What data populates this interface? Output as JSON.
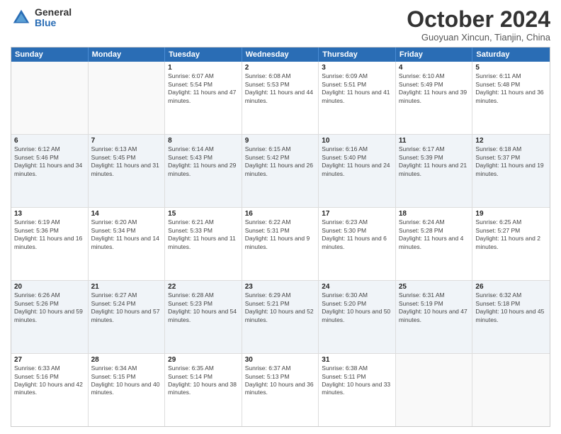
{
  "logo": {
    "general": "General",
    "blue": "Blue"
  },
  "title": "October 2024",
  "subtitle": "Guoyuan Xincun, Tianjin, China",
  "header_days": [
    "Sunday",
    "Monday",
    "Tuesday",
    "Wednesday",
    "Thursday",
    "Friday",
    "Saturday"
  ],
  "weeks": [
    [
      {
        "day": "",
        "sunrise": "",
        "sunset": "",
        "daylight": "",
        "empty": true
      },
      {
        "day": "",
        "sunrise": "",
        "sunset": "",
        "daylight": "",
        "empty": true
      },
      {
        "day": "1",
        "sunrise": "Sunrise: 6:07 AM",
        "sunset": "Sunset: 5:54 PM",
        "daylight": "Daylight: 11 hours and 47 minutes.",
        "empty": false
      },
      {
        "day": "2",
        "sunrise": "Sunrise: 6:08 AM",
        "sunset": "Sunset: 5:53 PM",
        "daylight": "Daylight: 11 hours and 44 minutes.",
        "empty": false
      },
      {
        "day": "3",
        "sunrise": "Sunrise: 6:09 AM",
        "sunset": "Sunset: 5:51 PM",
        "daylight": "Daylight: 11 hours and 41 minutes.",
        "empty": false
      },
      {
        "day": "4",
        "sunrise": "Sunrise: 6:10 AM",
        "sunset": "Sunset: 5:49 PM",
        "daylight": "Daylight: 11 hours and 39 minutes.",
        "empty": false
      },
      {
        "day": "5",
        "sunrise": "Sunrise: 6:11 AM",
        "sunset": "Sunset: 5:48 PM",
        "daylight": "Daylight: 11 hours and 36 minutes.",
        "empty": false
      }
    ],
    [
      {
        "day": "6",
        "sunrise": "Sunrise: 6:12 AM",
        "sunset": "Sunset: 5:46 PM",
        "daylight": "Daylight: 11 hours and 34 minutes.",
        "empty": false
      },
      {
        "day": "7",
        "sunrise": "Sunrise: 6:13 AM",
        "sunset": "Sunset: 5:45 PM",
        "daylight": "Daylight: 11 hours and 31 minutes.",
        "empty": false
      },
      {
        "day": "8",
        "sunrise": "Sunrise: 6:14 AM",
        "sunset": "Sunset: 5:43 PM",
        "daylight": "Daylight: 11 hours and 29 minutes.",
        "empty": false
      },
      {
        "day": "9",
        "sunrise": "Sunrise: 6:15 AM",
        "sunset": "Sunset: 5:42 PM",
        "daylight": "Daylight: 11 hours and 26 minutes.",
        "empty": false
      },
      {
        "day": "10",
        "sunrise": "Sunrise: 6:16 AM",
        "sunset": "Sunset: 5:40 PM",
        "daylight": "Daylight: 11 hours and 24 minutes.",
        "empty": false
      },
      {
        "day": "11",
        "sunrise": "Sunrise: 6:17 AM",
        "sunset": "Sunset: 5:39 PM",
        "daylight": "Daylight: 11 hours and 21 minutes.",
        "empty": false
      },
      {
        "day": "12",
        "sunrise": "Sunrise: 6:18 AM",
        "sunset": "Sunset: 5:37 PM",
        "daylight": "Daylight: 11 hours and 19 minutes.",
        "empty": false
      }
    ],
    [
      {
        "day": "13",
        "sunrise": "Sunrise: 6:19 AM",
        "sunset": "Sunset: 5:36 PM",
        "daylight": "Daylight: 11 hours and 16 minutes.",
        "empty": false
      },
      {
        "day": "14",
        "sunrise": "Sunrise: 6:20 AM",
        "sunset": "Sunset: 5:34 PM",
        "daylight": "Daylight: 11 hours and 14 minutes.",
        "empty": false
      },
      {
        "day": "15",
        "sunrise": "Sunrise: 6:21 AM",
        "sunset": "Sunset: 5:33 PM",
        "daylight": "Daylight: 11 hours and 11 minutes.",
        "empty": false
      },
      {
        "day": "16",
        "sunrise": "Sunrise: 6:22 AM",
        "sunset": "Sunset: 5:31 PM",
        "daylight": "Daylight: 11 hours and 9 minutes.",
        "empty": false
      },
      {
        "day": "17",
        "sunrise": "Sunrise: 6:23 AM",
        "sunset": "Sunset: 5:30 PM",
        "daylight": "Daylight: 11 hours and 6 minutes.",
        "empty": false
      },
      {
        "day": "18",
        "sunrise": "Sunrise: 6:24 AM",
        "sunset": "Sunset: 5:28 PM",
        "daylight": "Daylight: 11 hours and 4 minutes.",
        "empty": false
      },
      {
        "day": "19",
        "sunrise": "Sunrise: 6:25 AM",
        "sunset": "Sunset: 5:27 PM",
        "daylight": "Daylight: 11 hours and 2 minutes.",
        "empty": false
      }
    ],
    [
      {
        "day": "20",
        "sunrise": "Sunrise: 6:26 AM",
        "sunset": "Sunset: 5:26 PM",
        "daylight": "Daylight: 10 hours and 59 minutes.",
        "empty": false
      },
      {
        "day": "21",
        "sunrise": "Sunrise: 6:27 AM",
        "sunset": "Sunset: 5:24 PM",
        "daylight": "Daylight: 10 hours and 57 minutes.",
        "empty": false
      },
      {
        "day": "22",
        "sunrise": "Sunrise: 6:28 AM",
        "sunset": "Sunset: 5:23 PM",
        "daylight": "Daylight: 10 hours and 54 minutes.",
        "empty": false
      },
      {
        "day": "23",
        "sunrise": "Sunrise: 6:29 AM",
        "sunset": "Sunset: 5:21 PM",
        "daylight": "Daylight: 10 hours and 52 minutes.",
        "empty": false
      },
      {
        "day": "24",
        "sunrise": "Sunrise: 6:30 AM",
        "sunset": "Sunset: 5:20 PM",
        "daylight": "Daylight: 10 hours and 50 minutes.",
        "empty": false
      },
      {
        "day": "25",
        "sunrise": "Sunrise: 6:31 AM",
        "sunset": "Sunset: 5:19 PM",
        "daylight": "Daylight: 10 hours and 47 minutes.",
        "empty": false
      },
      {
        "day": "26",
        "sunrise": "Sunrise: 6:32 AM",
        "sunset": "Sunset: 5:18 PM",
        "daylight": "Daylight: 10 hours and 45 minutes.",
        "empty": false
      }
    ],
    [
      {
        "day": "27",
        "sunrise": "Sunrise: 6:33 AM",
        "sunset": "Sunset: 5:16 PM",
        "daylight": "Daylight: 10 hours and 42 minutes.",
        "empty": false
      },
      {
        "day": "28",
        "sunrise": "Sunrise: 6:34 AM",
        "sunset": "Sunset: 5:15 PM",
        "daylight": "Daylight: 10 hours and 40 minutes.",
        "empty": false
      },
      {
        "day": "29",
        "sunrise": "Sunrise: 6:35 AM",
        "sunset": "Sunset: 5:14 PM",
        "daylight": "Daylight: 10 hours and 38 minutes.",
        "empty": false
      },
      {
        "day": "30",
        "sunrise": "Sunrise: 6:37 AM",
        "sunset": "Sunset: 5:13 PM",
        "daylight": "Daylight: 10 hours and 36 minutes.",
        "empty": false
      },
      {
        "day": "31",
        "sunrise": "Sunrise: 6:38 AM",
        "sunset": "Sunset: 5:11 PM",
        "daylight": "Daylight: 10 hours and 33 minutes.",
        "empty": false
      },
      {
        "day": "",
        "sunrise": "",
        "sunset": "",
        "daylight": "",
        "empty": true
      },
      {
        "day": "",
        "sunrise": "",
        "sunset": "",
        "daylight": "",
        "empty": true
      }
    ]
  ]
}
